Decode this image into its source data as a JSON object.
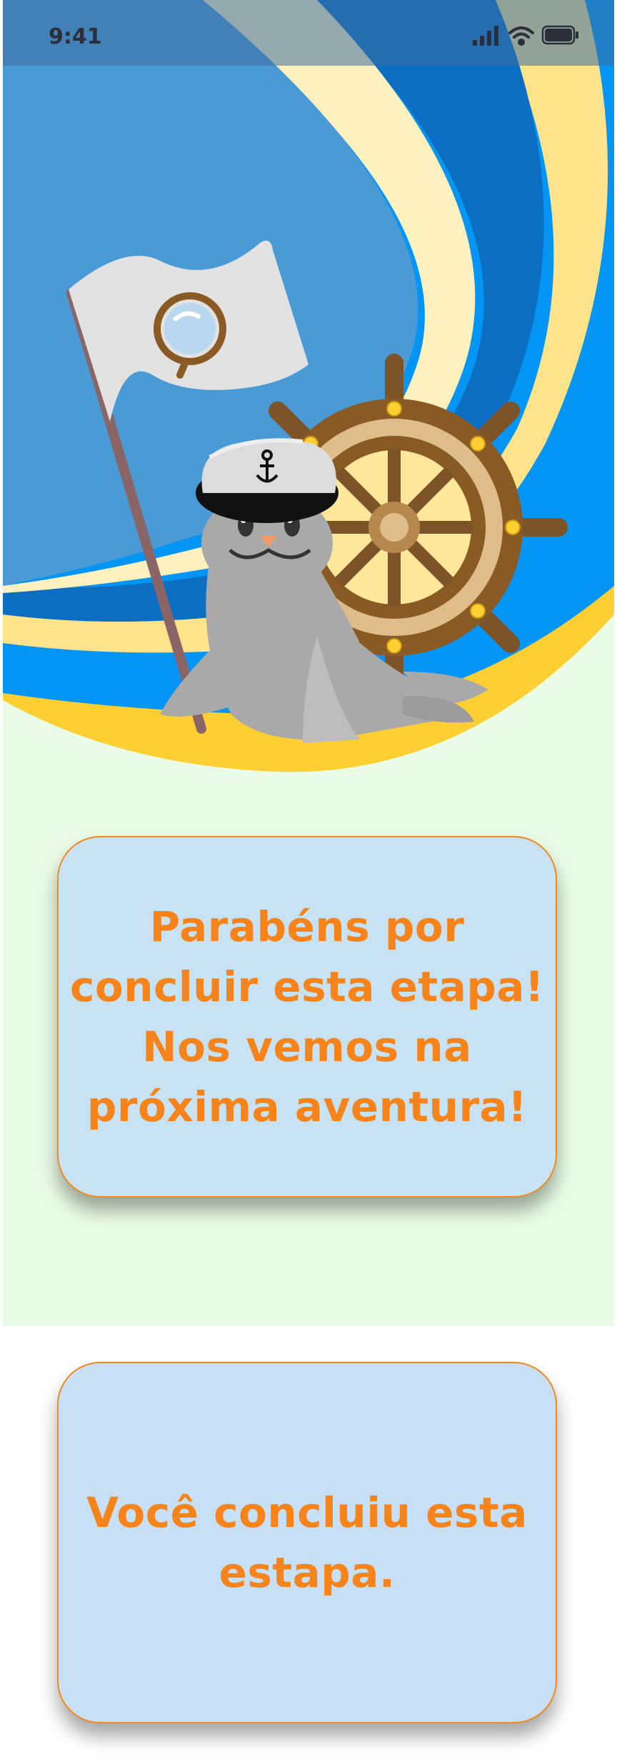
{
  "status_bar": {
    "time": "9:41",
    "icons": [
      "signal-icon",
      "wifi-icon",
      "battery-icon"
    ]
  },
  "hero": {
    "illustration": "sailor-seal-with-flag-and-ship-wheel",
    "colors": {
      "sky_light": "#4a9ad6",
      "sky_dark": "#0b6ec0",
      "wave_cream": "#fff1bd",
      "wave_blue": "#0395f4",
      "sand": "#fecf32",
      "background": "#e9fce6"
    }
  },
  "cards": [
    {
      "text": "Parabéns por\nconcluir esta etapa!\nNos vemos na\npróxima aventura!"
    },
    {
      "text": "Você concluiu esta\nestapa."
    }
  ],
  "colors": {
    "accent_text": "#f7841b",
    "card_border": "#f08a1c",
    "card_1_bg": "#c7e2f3",
    "card_2_bg": "#c7e0f6"
  }
}
